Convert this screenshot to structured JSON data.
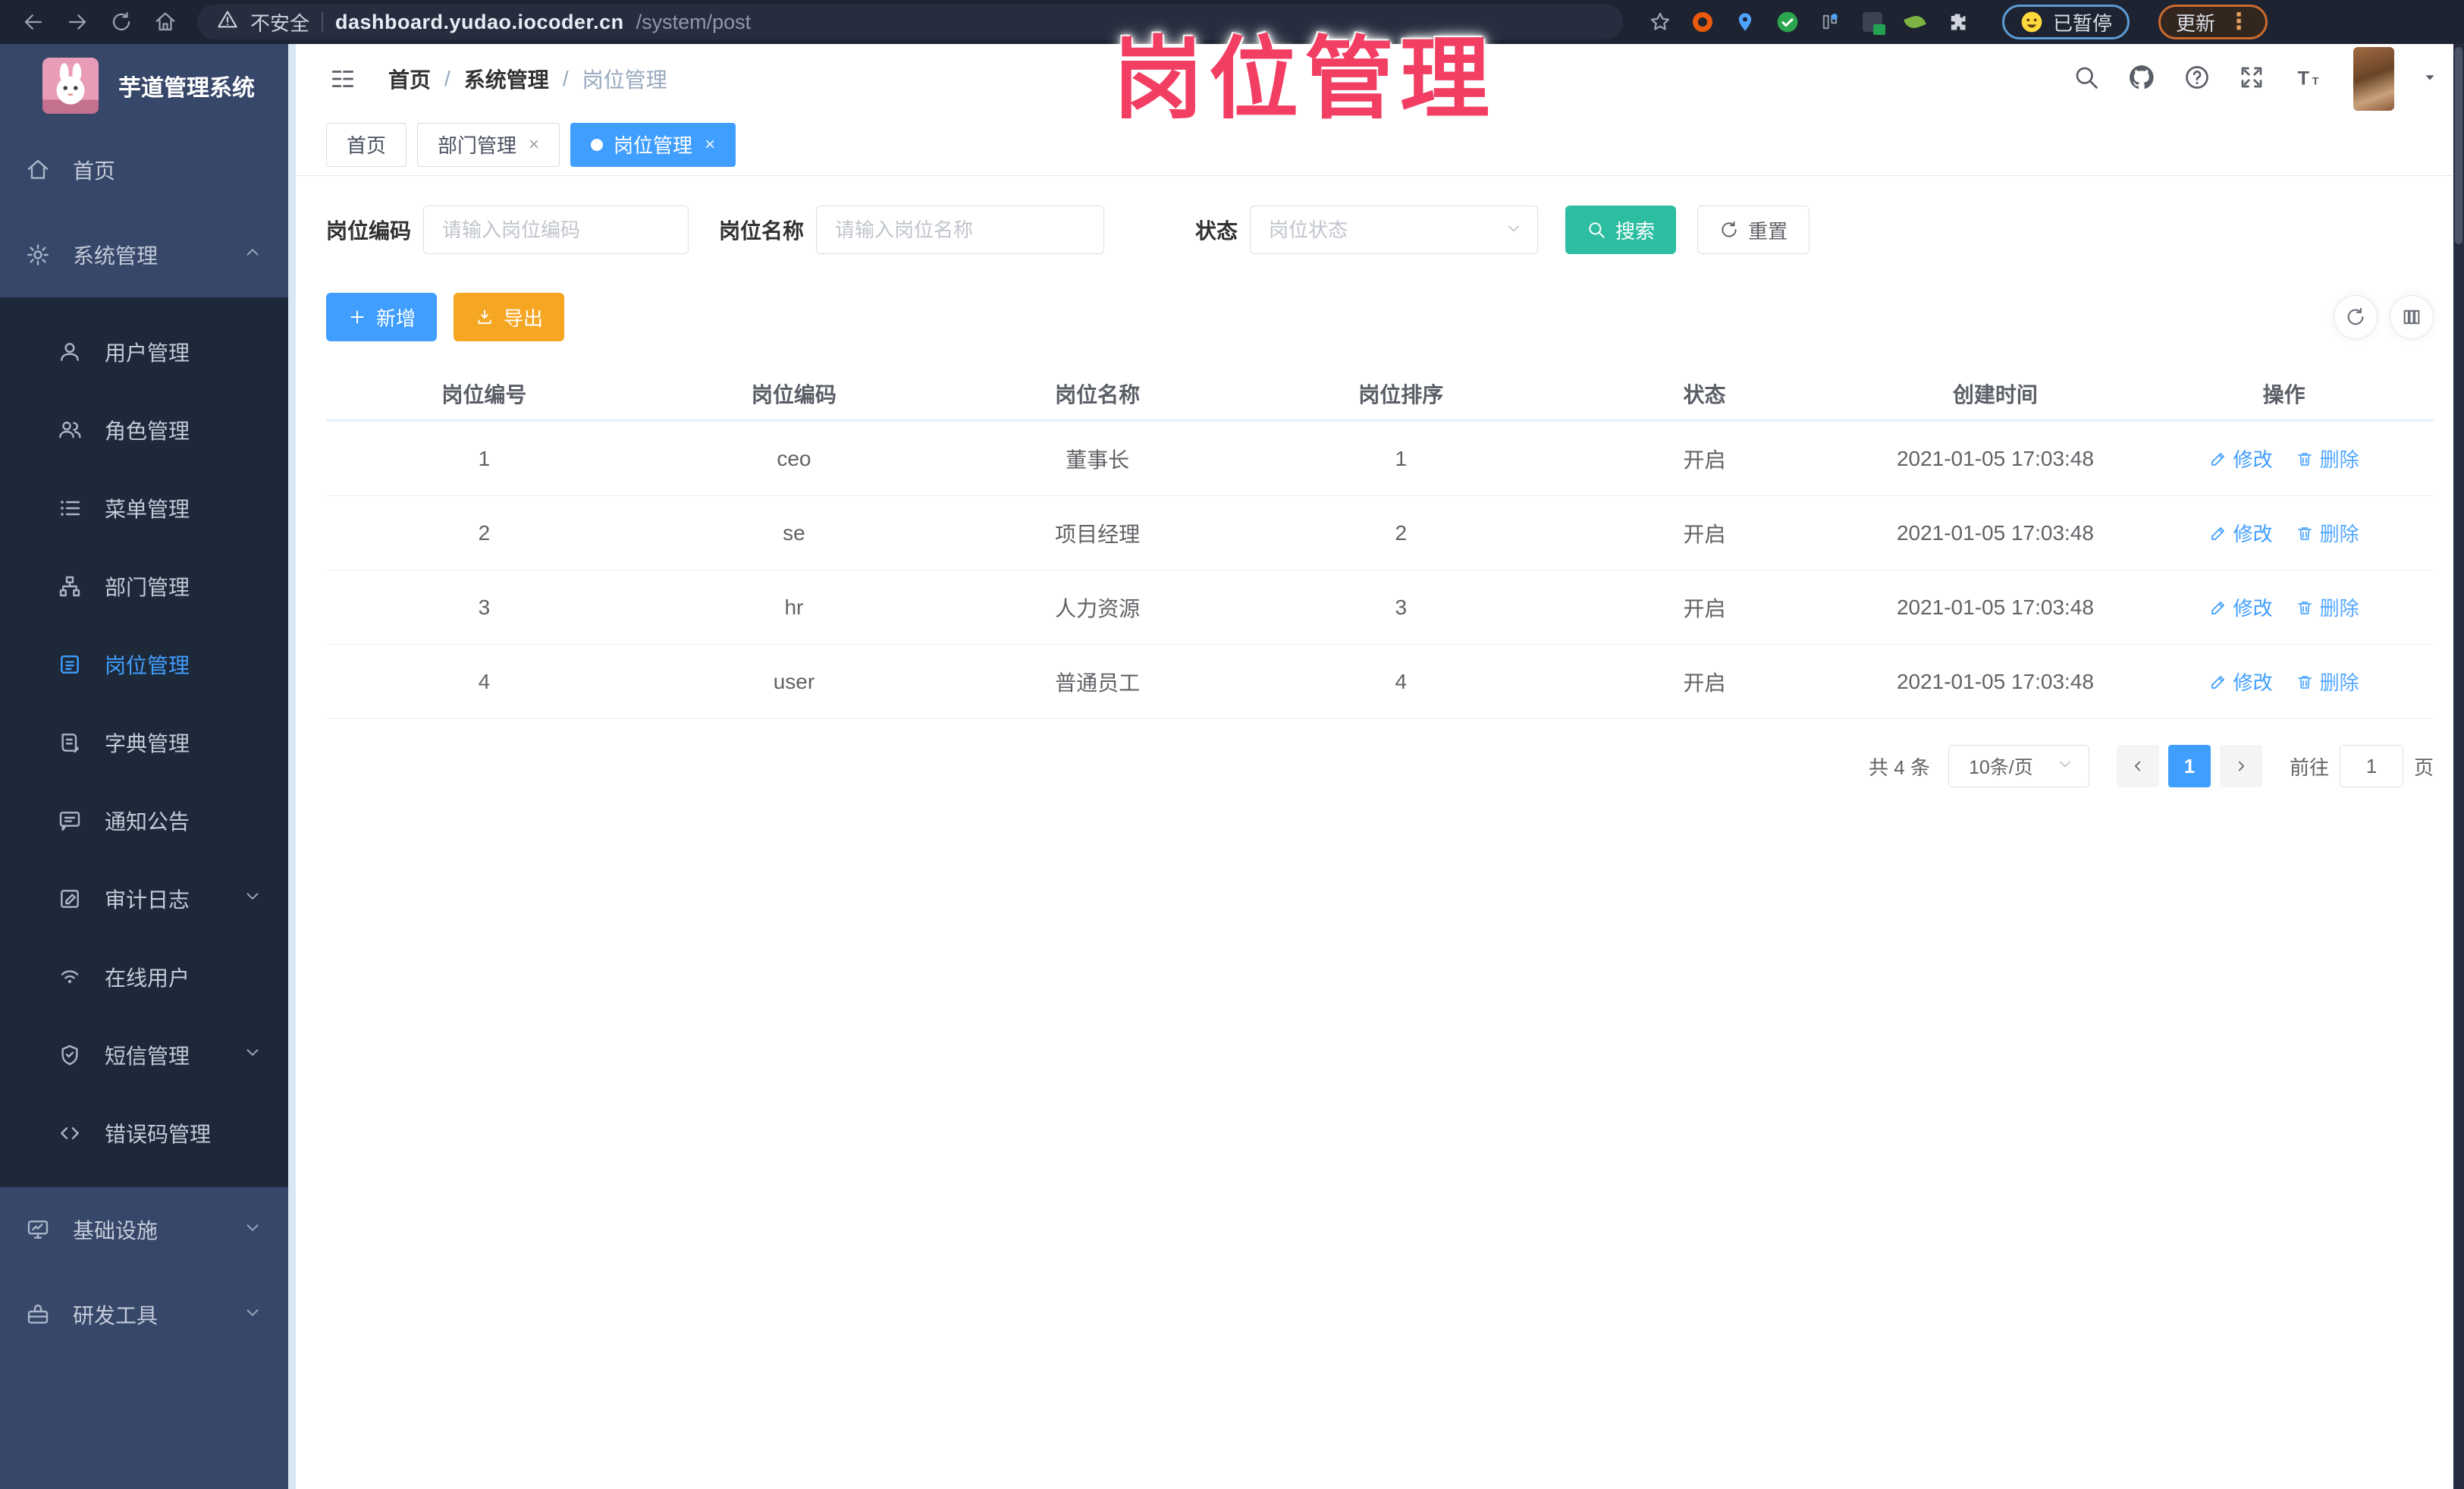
{
  "browser": {
    "security_label": "不安全",
    "url_host": "dashboard.yudao.iocoder.cn",
    "url_path": "/system/post",
    "paused_label": "已暂停",
    "update_label": "更新",
    "menu_glyph": "⋮"
  },
  "overlay": {
    "title": "岗位管理"
  },
  "colors": {
    "primary": "#409eff",
    "search_button": "#2dbda1",
    "export_button": "#f5a623",
    "overlay_pink": "#f23e63",
    "sidebar_bg": "#374769",
    "submenu_bg": "#1d2939"
  },
  "sidebar": {
    "app_title": "芋道管理系统",
    "items": [
      {
        "label": "首页"
      },
      {
        "label": "系统管理"
      },
      {
        "label": "用户管理"
      },
      {
        "label": "角色管理"
      },
      {
        "label": "菜单管理"
      },
      {
        "label": "部门管理"
      },
      {
        "label": "岗位管理"
      },
      {
        "label": "字典管理"
      },
      {
        "label": "通知公告"
      },
      {
        "label": "审计日志"
      },
      {
        "label": "在线用户"
      },
      {
        "label": "短信管理"
      },
      {
        "label": "错误码管理"
      },
      {
        "label": "基础设施"
      },
      {
        "label": "研发工具"
      }
    ]
  },
  "header": {
    "breadcrumb": [
      "首页",
      "系统管理",
      "岗位管理"
    ],
    "separator": "/"
  },
  "tabs": [
    {
      "label": "首页"
    },
    {
      "label": "部门管理",
      "close": "×"
    },
    {
      "label": "岗位管理",
      "close": "×"
    }
  ],
  "filters": {
    "code_label": "岗位编码",
    "code_placeholder": "请输入岗位编码",
    "name_label": "岗位名称",
    "name_placeholder": "请输入岗位名称",
    "status_label": "状态",
    "status_placeholder": "岗位状态",
    "search_label": "搜索",
    "reset_label": "重置"
  },
  "toolbar": {
    "add_label": "新增",
    "export_label": "导出"
  },
  "table": {
    "headers": [
      "岗位编号",
      "岗位编码",
      "岗位名称",
      "岗位排序",
      "状态",
      "创建时间",
      "操作"
    ],
    "edit_label": "修改",
    "delete_label": "删除",
    "rows": [
      {
        "id": "1",
        "code": "ceo",
        "name": "董事长",
        "sort": "1",
        "status": "开启",
        "created": "2021-01-05 17:03:48"
      },
      {
        "id": "2",
        "code": "se",
        "name": "项目经理",
        "sort": "2",
        "status": "开启",
        "created": "2021-01-05 17:03:48"
      },
      {
        "id": "3",
        "code": "hr",
        "name": "人力资源",
        "sort": "3",
        "status": "开启",
        "created": "2021-01-05 17:03:48"
      },
      {
        "id": "4",
        "code": "user",
        "name": "普通员工",
        "sort": "4",
        "status": "开启",
        "created": "2021-01-05 17:03:48"
      }
    ]
  },
  "pagination": {
    "total_label": "共 4 条",
    "page_size_label": "10条/页",
    "current_page": "1",
    "goto_label": "前往",
    "goto_value": "1",
    "page_unit": "页"
  }
}
